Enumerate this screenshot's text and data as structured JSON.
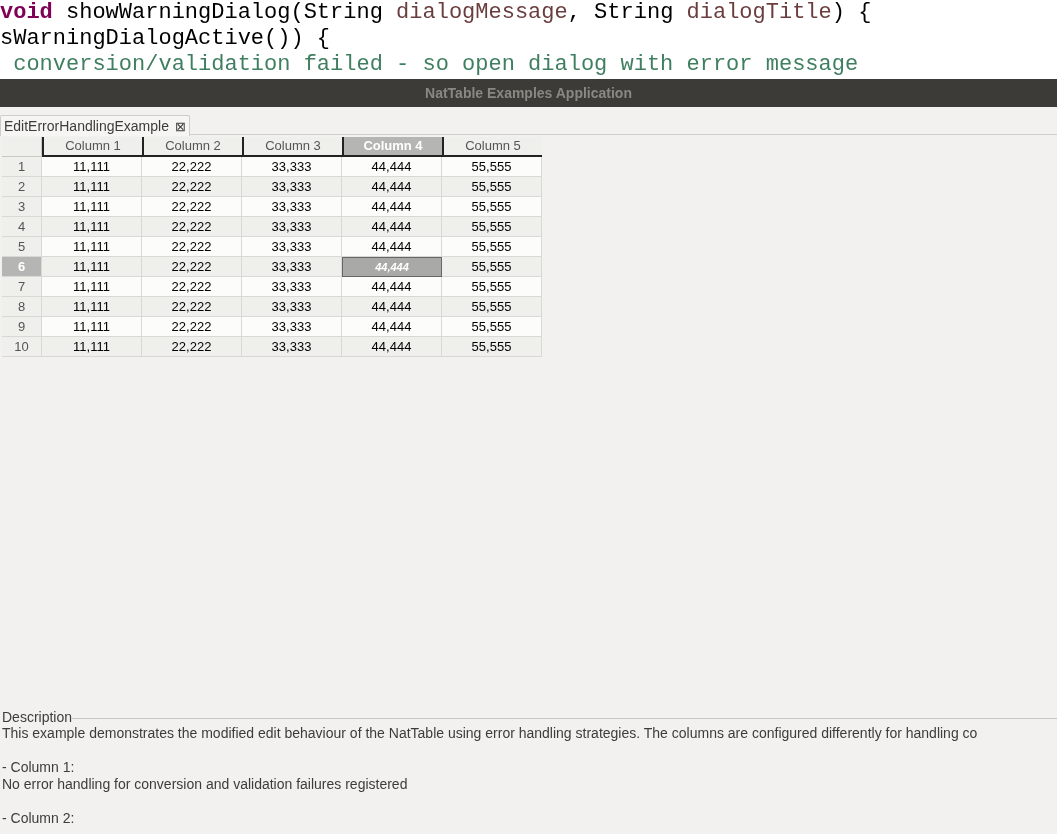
{
  "code_lines": [
    [
      {
        "kind": "keyword",
        "text": "void"
      },
      {
        "kind": "plain",
        "text": " showWarningDialog(String "
      },
      {
        "kind": "variable",
        "text": "dialogMessage"
      },
      {
        "kind": "plain",
        "text": ", String "
      },
      {
        "kind": "variable",
        "text": "dialogTitle"
      },
      {
        "kind": "plain",
        "text": ") {"
      }
    ],
    [
      {
        "kind": "plain",
        "text": "sWarningDialogActive()) {"
      }
    ],
    [
      {
        "kind": "comment",
        "text": " conversion/validation failed - so open dialog with error message"
      }
    ]
  ],
  "window": {
    "title": "NatTable Examples Application"
  },
  "tabs": [
    {
      "label": "EditErrorHandlingExample",
      "selected": true,
      "close": "⊠"
    }
  ],
  "table": {
    "columns": [
      {
        "label": "Column 1",
        "selected": false
      },
      {
        "label": "Column 2",
        "selected": false
      },
      {
        "label": "Column 3",
        "selected": false
      },
      {
        "label": "Column 4",
        "selected": true
      },
      {
        "label": "Column 5",
        "selected": false
      }
    ],
    "rows": [
      {
        "header": "1",
        "selected": false,
        "cells": [
          {
            "text": "11,111",
            "selected": false
          },
          {
            "text": "22,222",
            "selected": false
          },
          {
            "text": "33,333",
            "selected": false
          },
          {
            "text": "44,444",
            "selected": false
          },
          {
            "text": "55,555",
            "selected": false
          }
        ]
      },
      {
        "header": "2",
        "selected": false,
        "cells": [
          {
            "text": "11,111",
            "selected": false
          },
          {
            "text": "22,222",
            "selected": false
          },
          {
            "text": "33,333",
            "selected": false
          },
          {
            "text": "44,444",
            "selected": false
          },
          {
            "text": "55,555",
            "selected": false
          }
        ]
      },
      {
        "header": "3",
        "selected": false,
        "cells": [
          {
            "text": "11,111",
            "selected": false
          },
          {
            "text": "22,222",
            "selected": false
          },
          {
            "text": "33,333",
            "selected": false
          },
          {
            "text": "44,444",
            "selected": false
          },
          {
            "text": "55,555",
            "selected": false
          }
        ]
      },
      {
        "header": "4",
        "selected": false,
        "cells": [
          {
            "text": "11,111",
            "selected": false
          },
          {
            "text": "22,222",
            "selected": false
          },
          {
            "text": "33,333",
            "selected": false
          },
          {
            "text": "44,444",
            "selected": false
          },
          {
            "text": "55,555",
            "selected": false
          }
        ]
      },
      {
        "header": "5",
        "selected": false,
        "cells": [
          {
            "text": "11,111",
            "selected": false
          },
          {
            "text": "22,222",
            "selected": false
          },
          {
            "text": "33,333",
            "selected": false
          },
          {
            "text": "44,444",
            "selected": false
          },
          {
            "text": "55,555",
            "selected": false
          }
        ]
      },
      {
        "header": "6",
        "selected": true,
        "cells": [
          {
            "text": "11,111",
            "selected": false
          },
          {
            "text": "22,222",
            "selected": false
          },
          {
            "text": "33,333",
            "selected": false
          },
          {
            "text": "44,444",
            "selected": true
          },
          {
            "text": "55,555",
            "selected": false
          }
        ]
      },
      {
        "header": "7",
        "selected": false,
        "cells": [
          {
            "text": "11,111",
            "selected": false
          },
          {
            "text": "22,222",
            "selected": false
          },
          {
            "text": "33,333",
            "selected": false
          },
          {
            "text": "44,444",
            "selected": false
          },
          {
            "text": "55,555",
            "selected": false
          }
        ]
      },
      {
        "header": "8",
        "selected": false,
        "cells": [
          {
            "text": "11,111",
            "selected": false
          },
          {
            "text": "22,222",
            "selected": false
          },
          {
            "text": "33,333",
            "selected": false
          },
          {
            "text": "44,444",
            "selected": false
          },
          {
            "text": "55,555",
            "selected": false
          }
        ]
      },
      {
        "header": "9",
        "selected": false,
        "cells": [
          {
            "text": "11,111",
            "selected": false
          },
          {
            "text": "22,222",
            "selected": false
          },
          {
            "text": "33,333",
            "selected": false
          },
          {
            "text": "44,444",
            "selected": false
          },
          {
            "text": "55,555",
            "selected": false
          }
        ]
      },
      {
        "header": "10",
        "selected": false,
        "cells": [
          {
            "text": "11,111",
            "selected": false
          },
          {
            "text": "22,222",
            "selected": false
          },
          {
            "text": "33,333",
            "selected": false
          },
          {
            "text": "44,444",
            "selected": false
          },
          {
            "text": "55,555",
            "selected": false
          }
        ]
      }
    ]
  },
  "description": {
    "legend": "Description",
    "paragraphs": [
      [
        "This example demonstrates the modified edit behaviour of the NatTable using error handling strategies. The columns are configured differently for handling co"
      ],
      [
        "- Column 1:",
        "No error handling for conversion and validation failures registered"
      ],
      [
        "- Column 2:"
      ]
    ]
  }
}
